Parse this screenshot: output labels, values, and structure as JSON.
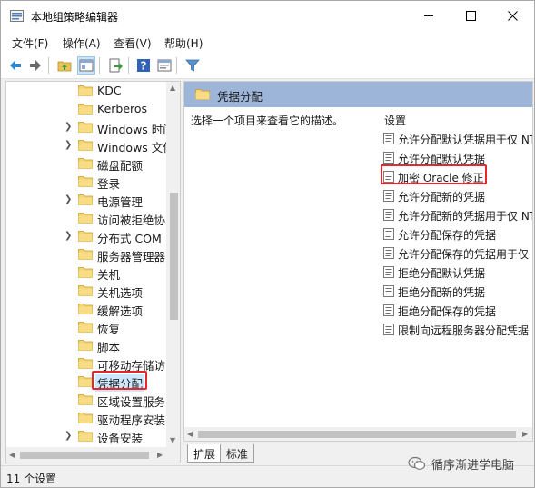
{
  "window": {
    "title": "本地组策略编辑器"
  },
  "menu": [
    {
      "label": "文件(F)"
    },
    {
      "label": "操作(A)"
    },
    {
      "label": "查看(V)"
    },
    {
      "label": "帮助(H)"
    }
  ],
  "tree": {
    "items": [
      {
        "label": "KDC",
        "expandable": false
      },
      {
        "label": "Kerberos",
        "expandable": false
      },
      {
        "label": "Windows 时间服务",
        "expandable": true
      },
      {
        "label": "Windows 文件保护",
        "expandable": true
      },
      {
        "label": "磁盘配额",
        "expandable": false
      },
      {
        "label": "登录",
        "expandable": false
      },
      {
        "label": "电源管理",
        "expandable": true
      },
      {
        "label": "访问被拒绝协助",
        "expandable": false
      },
      {
        "label": "分布式 COM",
        "expandable": true
      },
      {
        "label": "服务器管理器",
        "expandable": false
      },
      {
        "label": "关机",
        "expandable": false
      },
      {
        "label": "关机选项",
        "expandable": false
      },
      {
        "label": "缓解选项",
        "expandable": false
      },
      {
        "label": "恢复",
        "expandable": false
      },
      {
        "label": "脚本",
        "expandable": false
      },
      {
        "label": "可移动存储访问",
        "expandable": false
      },
      {
        "label": "凭据分配",
        "expandable": false,
        "selected": true
      },
      {
        "label": "区域设置服务",
        "expandable": false
      },
      {
        "label": "驱动程序安装",
        "expandable": false
      },
      {
        "label": "设备安装",
        "expandable": true
      }
    ]
  },
  "right": {
    "header": "凭据分配",
    "description": "选择一个项目来查看它的描述。",
    "settings_label": "设置",
    "settings": [
      {
        "label": "允许分配默认凭据用于仅 NTLM 服务器身份验证"
      },
      {
        "label": "允许分配默认凭据"
      },
      {
        "label": "加密 Oracle 修正",
        "highlight": true
      },
      {
        "label": "允许分配新的凭据"
      },
      {
        "label": "允许分配新的凭据用于仅 NTLM 服务器身份验证"
      },
      {
        "label": "允许分配保存的凭据"
      },
      {
        "label": "允许分配保存的凭据用于仅 NTLM 服务器身份验证"
      },
      {
        "label": "拒绝分配默认凭据"
      },
      {
        "label": "拒绝分配新的凭据"
      },
      {
        "label": "拒绝分配保存的凭据"
      },
      {
        "label": "限制向远程服务器分配凭据"
      }
    ]
  },
  "tabs": [
    {
      "label": "扩展"
    },
    {
      "label": "标准"
    }
  ],
  "status": {
    "text": "11 个设置"
  },
  "watermark": {
    "text": "循序渐进学电脑"
  },
  "colors": {
    "highlight": "#e8262b",
    "header_bg": "#9db5d8",
    "selection": "#cce8ff"
  }
}
